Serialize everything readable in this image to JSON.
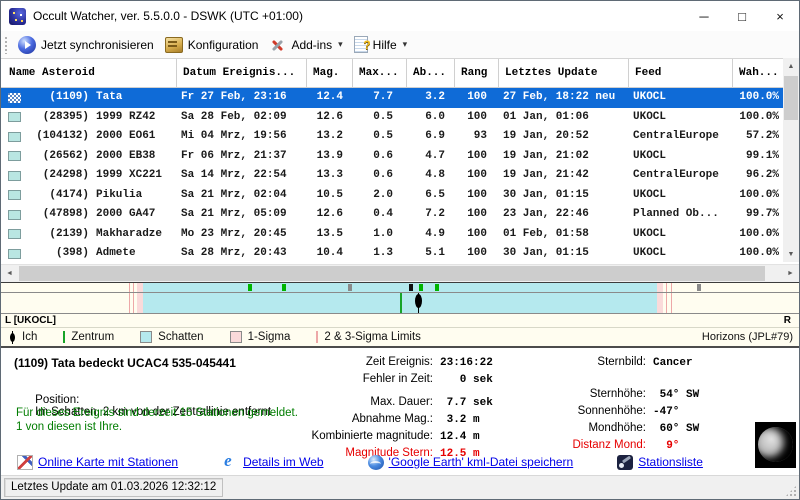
{
  "window": {
    "title": "Occult Watcher, ver. 5.5.0.0 - DSWK (UTC +01:00)"
  },
  "icons": {
    "minimize": "─",
    "maximize": "□",
    "close": "×",
    "dropdown": "▾",
    "scroll_up": "▲",
    "scroll_down": "▼",
    "scroll_left": "◄",
    "scroll_right": "►"
  },
  "toolbar": {
    "sync_label": "Jetzt synchronisieren",
    "config_label": "Konfiguration",
    "addins_label": "Add-ins",
    "help_label": "Hilfe"
  },
  "table": {
    "columns": [
      "Name Asteroid",
      "Datum Ereignis...",
      "Mag.",
      "Max...",
      "Ab...",
      "Rang",
      "Letztes Update",
      "Feed",
      "Wah..."
    ],
    "rows": [
      {
        "num": "(1109)",
        "name": "Tata",
        "datum": "Fr 27 Feb, 23:16",
        "mag": "12.4",
        "max": "7.7",
        "ab": "3.2",
        "rang": "100",
        "update": "27 Feb, 18:22 neu",
        "feed": "UKOCL",
        "wah": "100.0%",
        "selected": true
      },
      {
        "num": "(28395)",
        "name": "1999 RZ42",
        "datum": "Sa 28 Feb, 02:09",
        "mag": "12.6",
        "max": "0.5",
        "ab": "6.0",
        "rang": "100",
        "update": "01 Jan, 01:06",
        "feed": "UKOCL",
        "wah": "100.0%"
      },
      {
        "num": "(104132)",
        "name": "2000 EO61",
        "datum": "Mi 04 Mrz, 19:56",
        "mag": "13.2",
        "max": "0.5",
        "ab": "6.9",
        "rang": "93",
        "update": "19 Jan, 20:52",
        "feed": "CentralEurope",
        "wah": "57.2%"
      },
      {
        "num": "(26562)",
        "name": "2000 EB38",
        "datum": "Fr 06 Mrz, 21:37",
        "mag": "13.9",
        "max": "0.6",
        "ab": "4.7",
        "rang": "100",
        "update": "19 Jan, 21:02",
        "feed": "UKOCL",
        "wah": "99.1%"
      },
      {
        "num": "(24298)",
        "name": "1999 XC221",
        "datum": "Sa 14 Mrz, 22:54",
        "mag": "13.3",
        "max": "0.6",
        "ab": "4.8",
        "rang": "100",
        "update": "19 Jan, 21:42",
        "feed": "CentralEurope",
        "wah": "96.2%"
      },
      {
        "num": "(4174)",
        "name": "Pikulia",
        "datum": "Sa 21 Mrz, 02:04",
        "mag": "10.5",
        "max": "2.0",
        "ab": "6.5",
        "rang": "100",
        "update": "30 Jan, 01:15",
        "feed": "UKOCL",
        "wah": "100.0%"
      },
      {
        "num": "(47898)",
        "name": "2000 GA47",
        "datum": "Sa 21 Mrz, 05:09",
        "mag": "12.6",
        "max": "0.4",
        "ab": "7.2",
        "rang": "100",
        "update": "23 Jan, 22:46",
        "feed": "Planned Ob...",
        "wah": "99.7%"
      },
      {
        "num": "(2139)",
        "name": "Makharadze",
        "datum": "Mo 23 Mrz, 20:45",
        "mag": "13.5",
        "max": "1.0",
        "ab": "4.9",
        "rang": "100",
        "update": "01 Feb, 01:58",
        "feed": "UKOCL",
        "wah": "100.0%"
      },
      {
        "num": "(398)",
        "name": "Admete",
        "datum": "Sa 28 Mrz, 20:43",
        "mag": "10.4",
        "max": "1.3",
        "ab": "5.1",
        "rang": "100",
        "update": "30 Jan, 01:15",
        "feed": "UKOCL",
        "wah": "100.0%"
      }
    ]
  },
  "strip": {
    "label_left": "L [UKOCL]",
    "label_right": "R",
    "source_right": "Horizons (JPL#79)",
    "colors": {
      "shadow": "#b5e9ee",
      "sigma1": "#fadada",
      "sigma23_line": "#eda8a8",
      "center_line": "#18a428",
      "background": "#fffdf0"
    },
    "shadow_band": {
      "left": "17.75%",
      "width": "64.4%"
    },
    "sigma_band_left": {
      "left": "17.0%",
      "width": "0.78%"
    },
    "sigma_band_right": {
      "left": "82.15%",
      "width": "0.85%"
    },
    "sigma_lines": [
      {
        "style": {
          "left": "16.0%"
        }
      },
      {
        "style": {
          "left": "16.6%"
        }
      },
      {
        "style": {
          "left": "83.3%"
        }
      },
      {
        "style": {
          "left": "83.9%"
        }
      }
    ],
    "station_ticks": [
      {
        "style": {
          "left": "31.0%",
          "background": "#00b400"
        }
      },
      {
        "style": {
          "left": "35.25%",
          "background": "#00b400"
        }
      },
      {
        "style": {
          "left": "43.5%",
          "background": "#8a8a8a"
        }
      },
      {
        "style": {
          "left": "51.1%",
          "background": "#101010"
        }
      },
      {
        "style": {
          "left": "52.4%",
          "background": "#00b400"
        }
      },
      {
        "style": {
          "left": "54.4%",
          "background": "#00b400"
        }
      },
      {
        "style": {
          "left": "87.25%",
          "background": "#8a8a8a"
        }
      }
    ],
    "center_line_left": "50%",
    "my_station_left": "52.3%",
    "legend": {
      "ich": "Ich",
      "zentrum": "Zentrum",
      "schatten": "Schatten",
      "sigma1": "1-Sigma",
      "sigma23": "2 & 3-Sigma Limits"
    }
  },
  "details": {
    "title": "(1109) Tata bedeckt UCAC4 535-045441",
    "position_label": "Position:",
    "position_value": "Im Schatten, 2 km von der Zentrallinie entfernt",
    "stations_line1": "Für dieses Ereignis sind derzeit 15 Stationen gemeldet.",
    "stations_line2": "1 von diesen ist Ihre.",
    "mid_rows": [
      {
        "label": "Zeit Ereignis:",
        "value": "23:16:22"
      },
      {
        "label": "Fehler in Zeit:",
        "value": "   0 sek"
      },
      {
        "label": "Max. Dauer:",
        "value": " 7.7 sek",
        "cls": "gap"
      },
      {
        "label": "Abnahme Mag.:",
        "value": " 3.2 m"
      },
      {
        "label": "Kombinierte magnitude:",
        "value": "12.4 m"
      },
      {
        "label": "Magnitude Stern:",
        "value": "12.5 m",
        "cls": "red"
      }
    ],
    "right_rows": [
      {
        "label": "Sternbild:",
        "value": "Cancer"
      },
      {
        "label": "Sternhöhe:",
        "value": " 54° SW",
        "cls": "gap"
      },
      {
        "label": "Sonnenhöhe:",
        "value": "-47°"
      },
      {
        "label": "Mondhöhe:",
        "value": " 60° SW"
      },
      {
        "label": "Distanz Mond:",
        "value": "  9°",
        "cls": "red"
      }
    ]
  },
  "links": [
    {
      "label": "Online Karte mit Stationen",
      "icon": "icon-map",
      "name": "online-map-link"
    },
    {
      "label": "Details im Web",
      "icon": "icon-ie",
      "name": "web-details-link"
    },
    {
      "label": "'Google Earth' kml-Datei speichern",
      "icon": "icon-globe",
      "name": "google-earth-kml-link"
    },
    {
      "label": "Stationsliste",
      "icon": "icon-telescope",
      "name": "station-list-link"
    }
  ],
  "statusbar": {
    "text": "Letztes Update am 01.03.2026 12:32:12"
  }
}
